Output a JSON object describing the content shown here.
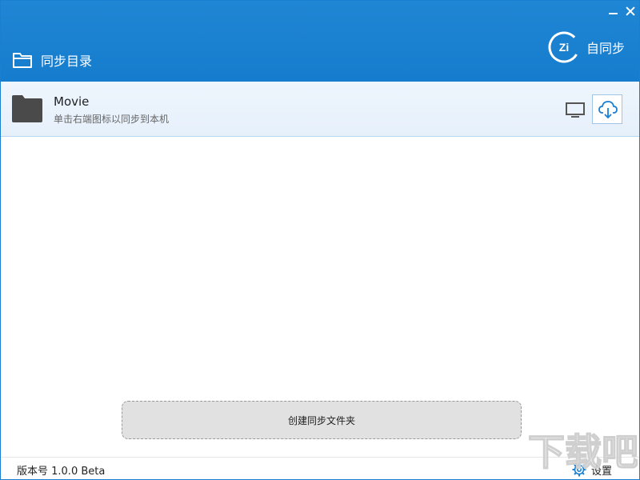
{
  "header": {
    "sync_dir_label": "同步目录",
    "brand_label": "自同步",
    "brand_logo_text": "Zi"
  },
  "folders": [
    {
      "name": "Movie",
      "hint": "单击右端图标以同步到本机"
    }
  ],
  "actions": {
    "create_label": "创建同步文件夹"
  },
  "footer": {
    "version": "版本号 1.0.0 Beta",
    "settings_label": "设置"
  },
  "watermark": {
    "text": "下载吧"
  },
  "colors": {
    "header_bg": "#1a80d0",
    "row_bg": "#eaf3fc",
    "accent": "#1a7fd0"
  }
}
